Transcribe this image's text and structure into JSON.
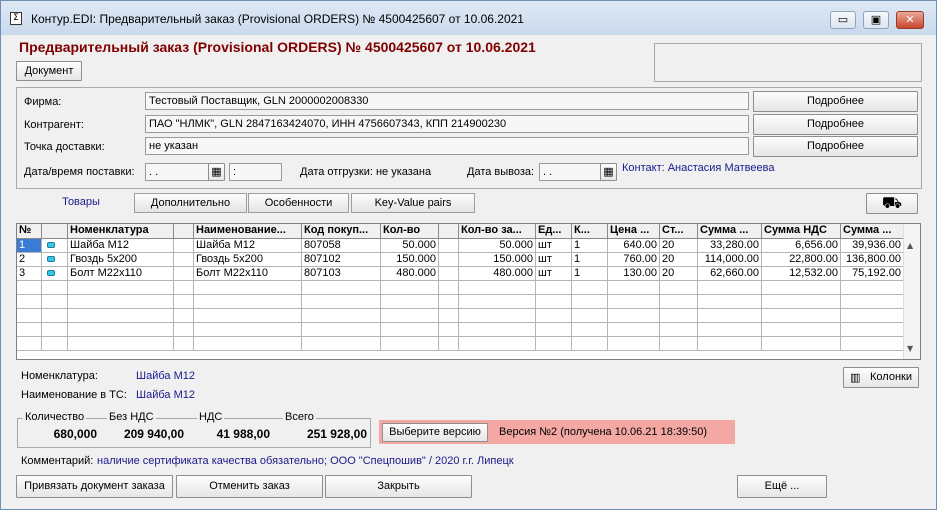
{
  "window": {
    "title": "Контур.EDI: Предварительный заказ (Provisional ORDERS) № 4500425607 от 10.06.2021",
    "app_icon_glyph": "Σ",
    "minimize_glyph": "▭",
    "maximize_glyph": "▣",
    "close_glyph": "✕"
  },
  "header": {
    "doc_title": "Предварительный заказ (Provisional ORDERS) № 4500425607 от 10.06.2021",
    "document_button": "Документ"
  },
  "form": {
    "firm_label": "Фирма:",
    "firm_value": "Тестовый Поставщик, GLN 2000002008330",
    "counterparty_label": "Контрагент:",
    "counterparty_value": "ПАО \"НЛМК\", GLN 2847163424070, ИНН 4756607343, КПП 214900230",
    "delivery_point_label": "Точка доставки:",
    "delivery_point_value": "не указан",
    "details_button": "Подробнее",
    "delivery_datetime_label": "Дата/время поставки:",
    "delivery_date_value": " .  .",
    "delivery_time_value": ":",
    "shipping_date_text": "Дата отгрузки: не указана",
    "pickup_date_label": "Дата вывоза:",
    "pickup_date_value": " .  .",
    "contact_text": "Контакт: Анастасия Матвеева",
    "calendar_icon_glyph": "▦"
  },
  "tabs": [
    {
      "label": "Товары"
    },
    {
      "label": "Дополнительно"
    },
    {
      "label": "Особенности"
    },
    {
      "label": "Key-Value pairs"
    }
  ],
  "truck_icon_glyph": "⛟",
  "table": {
    "columns": [
      "№",
      "",
      "Номенклатура",
      "",
      "Наименование...",
      "Код покуп...",
      "Кол-во",
      "",
      "Кол-во за...",
      "Ед...",
      "К...",
      "Цена ...",
      "Ст...",
      "Сумма ...",
      "Сумма НДС",
      "Сумма ..."
    ],
    "rows": [
      [
        "1",
        "",
        "Шайба М12",
        "",
        "Шайба М12",
        "807058",
        "50.000",
        "",
        "50.000",
        "шт",
        "1",
        "640.00",
        "20",
        "33,280.00",
        "6,656.00",
        "39,936.00"
      ],
      [
        "2",
        "",
        "Гвоздь 5x200",
        "",
        "Гвоздь 5x200",
        "807102",
        "150.000",
        "",
        "150.000",
        "шт",
        "1",
        "760.00",
        "20",
        "114,000.00",
        "22,800.00",
        "136,800.00"
      ],
      [
        "3",
        "",
        "Болт М22x110",
        "",
        "Болт М22x110",
        "807103",
        "480.000",
        "",
        "480.000",
        "шт",
        "1",
        "130.00",
        "20",
        "62,660.00",
        "12,532.00",
        "75,192.00"
      ]
    ],
    "scroll_up_glyph": "▲",
    "scroll_down_glyph": "▼"
  },
  "details": {
    "nomenclature_label": "Номенклатура:",
    "nomenclature_value": "Шайба М12",
    "ts_name_label": "Наименование в ТС:",
    "ts_name_value": "Шайба М12",
    "columns_button": "Колонки",
    "columns_icon_glyph": "▥"
  },
  "totals": {
    "quantity_label": "Количество",
    "quantity_value": "680,000",
    "without_vat_label": "Без НДС",
    "without_vat_value": "209 940,00",
    "vat_label": "НДС",
    "vat_value": "41 988,00",
    "total_label": "Всего",
    "total_value": "251 928,00"
  },
  "version": {
    "select_button": "Выберите версию",
    "version_text": "Версия №2 (получена 10.06.21 18:39:50)"
  },
  "comment": {
    "label": "Комментарий:",
    "value": "наличие сертификата качества обязательно; ООО \"Спецпошив\" / 2020 г.г. Липецк"
  },
  "footer": {
    "bind_order_button": "Привязать документ заказа",
    "cancel_order_button": "Отменить заказ",
    "close_button": "Закрыть",
    "more_button": "Ещё ..."
  },
  "colors": {
    "title_red": "#800000",
    "link_blue": "#1a1a8c",
    "version_bg": "#f4a8a3",
    "row_indicator": "#32c8e6"
  }
}
